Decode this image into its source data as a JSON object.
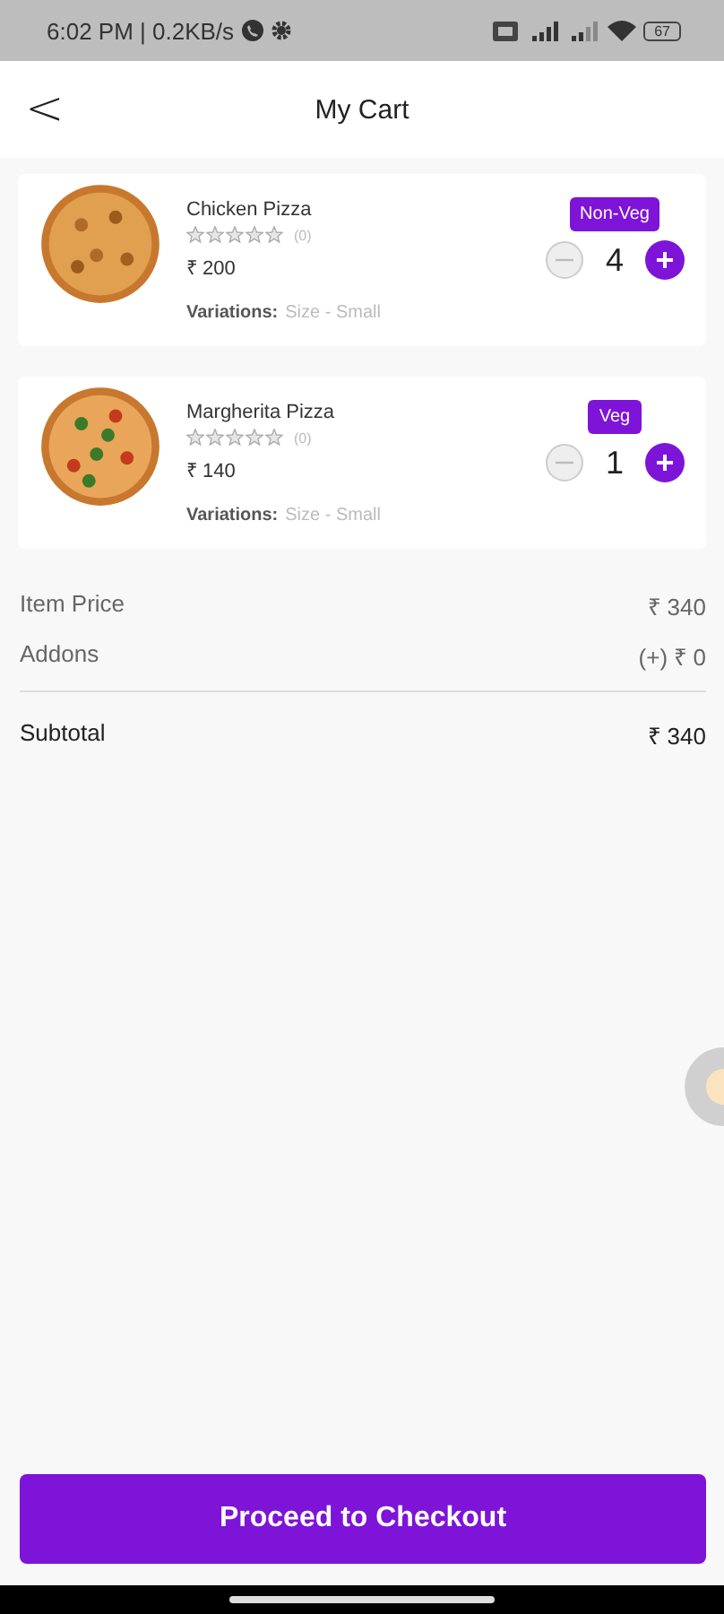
{
  "status_bar": {
    "time": "6:02 PM | 0.2KB/s",
    "battery": "67"
  },
  "header": {
    "back": "<",
    "title": "My Cart"
  },
  "items": [
    {
      "name": "Chicken Pizza",
      "stars": 0,
      "rating_count": "(0)",
      "price": "₹ 200",
      "badge": "Non-Veg",
      "quantity": "4",
      "variation_label": "Variations:",
      "variation_value": "Size - Small"
    },
    {
      "name": "Margherita Pizza",
      "stars": 0,
      "rating_count": "(0)",
      "price": "₹ 140",
      "badge": "Veg",
      "quantity": "1",
      "variation_label": "Variations:",
      "variation_value": "Size - Small"
    }
  ],
  "summary": [
    {
      "label": "Item Price",
      "value": "₹ 340",
      "kind": "line"
    },
    {
      "label": "Addons",
      "value": "(+) ₹ 0",
      "kind": "line"
    },
    {
      "label": "Subtotal",
      "value": "₹ 340",
      "kind": "total"
    }
  ],
  "checkout_button": "Proceed to Checkout"
}
